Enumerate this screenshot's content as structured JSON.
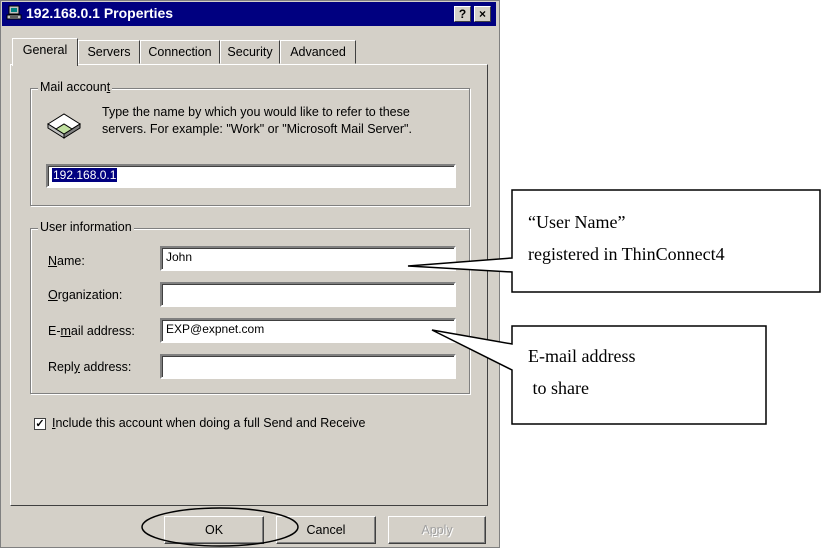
{
  "window": {
    "title": "192.168.0.1 Properties",
    "help_label": "?",
    "close_label": "×"
  },
  "tabs": [
    {
      "label": "General",
      "active": true
    },
    {
      "label": "Servers",
      "active": false
    },
    {
      "label": "Connection",
      "active": false
    },
    {
      "label": "Security",
      "active": false
    },
    {
      "label": "Advanced",
      "active": false
    }
  ],
  "mail_account": {
    "group_label_pre": "Mail accoun",
    "group_label_acc": "t",
    "description_line1": "Type the name by which you would like to refer to these",
    "description_line2": "servers.  For example: \"Work\" or \"Microsoft Mail Server\".",
    "account_name": "192.168.0.1",
    "icon": "mail-envelope-icon"
  },
  "user_information": {
    "group_label": "User information",
    "name_label_acc": "N",
    "name_label_rest": "ame:",
    "name_value": "John",
    "org_label_acc": "O",
    "org_label_rest": "rganization:",
    "org_value": "",
    "email_label_pre": "E-",
    "email_label_acc": "m",
    "email_label_rest": "ail address:",
    "email_value": "EXP@expnet.com",
    "reply_label_pre": "Repl",
    "reply_label_acc": "y",
    "reply_label_rest": " address:",
    "reply_value": ""
  },
  "include_checkbox": {
    "checked": true,
    "check_mark": "✓",
    "label_acc": "I",
    "label_rest": "nclude this account when doing a full Send and Receive"
  },
  "buttons": {
    "ok": "OK",
    "cancel": "Cancel",
    "apply_pre": "A",
    "apply_acc": "p",
    "apply_rest": "ply"
  },
  "callouts": {
    "user_name_line1": "“User Name”",
    "user_name_line2": "registered in ThinConnect4",
    "email_line1": "E-mail address",
    "email_line2": " to share"
  },
  "colors": {
    "titlebar": "#000080",
    "dialog_face": "#d4d0c8",
    "selection": "#000080"
  }
}
